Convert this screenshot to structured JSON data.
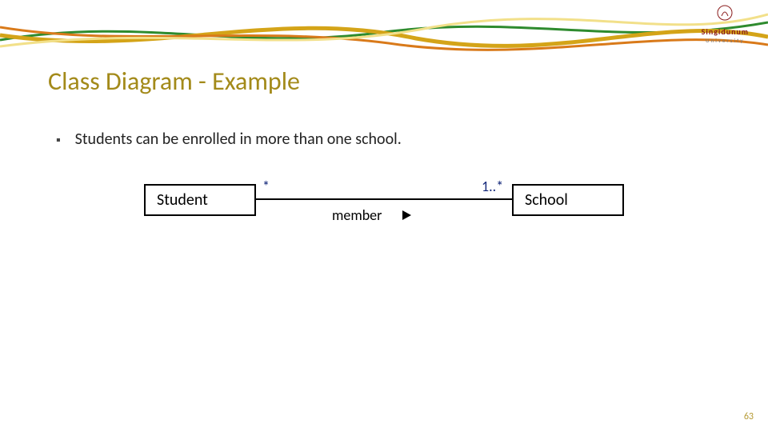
{
  "brand": {
    "name": "Singidunum",
    "subtitle": "University"
  },
  "slide": {
    "title": "Class Diagram - Example",
    "bullet_mark": "▪",
    "bullet": "Students can be enrolled in more than one school.",
    "page_number": "63"
  },
  "uml": {
    "left_class": "Student",
    "right_class": "School",
    "left_multiplicity": "*",
    "right_multiplicity": "1..*",
    "association_name": "member"
  }
}
